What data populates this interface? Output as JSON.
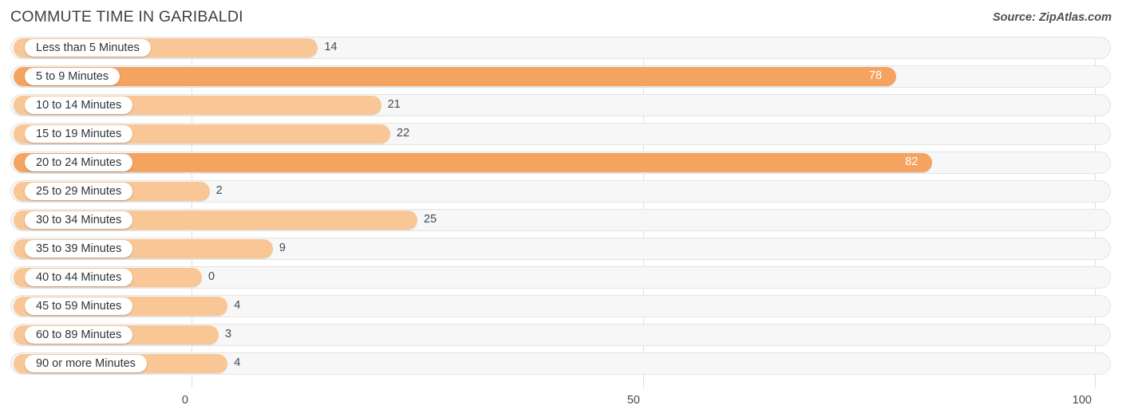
{
  "header": {
    "title": "COMMUTE TIME IN GARIBALDI",
    "source": "Source: ZipAtlas.com"
  },
  "axis": {
    "ticks": [
      {
        "label": "0",
        "value": 0
      },
      {
        "label": "50",
        "value": 50
      },
      {
        "label": "100",
        "value": 100
      }
    ]
  },
  "colors": {
    "bar_light": "#f9c696",
    "bar_strong": "#f4a460",
    "track": "#f7f7f7",
    "track_border": "#e3e3e3",
    "text": "#43484f",
    "title": "#3c4148"
  },
  "chart_data": {
    "type": "bar",
    "orientation": "horizontal",
    "title": "COMMUTE TIME IN GARIBALDI",
    "xlabel": "",
    "ylabel": "",
    "xlim": [
      0,
      100
    ],
    "grid": true,
    "legend": "none",
    "categories": [
      "Less than 5 Minutes",
      "5 to 9 Minutes",
      "10 to 14 Minutes",
      "15 to 19 Minutes",
      "20 to 24 Minutes",
      "25 to 29 Minutes",
      "30 to 34 Minutes",
      "35 to 39 Minutes",
      "40 to 44 Minutes",
      "45 to 59 Minutes",
      "60 to 89 Minutes",
      "90 or more Minutes"
    ],
    "values": [
      14,
      78,
      21,
      22,
      82,
      2,
      25,
      9,
      0,
      4,
      3,
      4
    ],
    "bars": [
      {
        "label": "Less than 5 Minutes",
        "value": 14,
        "value_text": "14",
        "highlight": false
      },
      {
        "label": "5 to 9 Minutes",
        "value": 78,
        "value_text": "78",
        "highlight": true
      },
      {
        "label": "10 to 14 Minutes",
        "value": 21,
        "value_text": "21",
        "highlight": false
      },
      {
        "label": "15 to 19 Minutes",
        "value": 22,
        "value_text": "22",
        "highlight": false
      },
      {
        "label": "20 to 24 Minutes",
        "value": 82,
        "value_text": "82",
        "highlight": true
      },
      {
        "label": "25 to 29 Minutes",
        "value": 2,
        "value_text": "2",
        "highlight": false
      },
      {
        "label": "30 to 34 Minutes",
        "value": 25,
        "value_text": "25",
        "highlight": false
      },
      {
        "label": "35 to 39 Minutes",
        "value": 9,
        "value_text": "9",
        "highlight": false
      },
      {
        "label": "40 to 44 Minutes",
        "value": 0,
        "value_text": "0",
        "highlight": false
      },
      {
        "label": "45 to 59 Minutes",
        "value": 4,
        "value_text": "4",
        "highlight": false
      },
      {
        "label": "60 to 89 Minutes",
        "value": 3,
        "value_text": "3",
        "highlight": false
      },
      {
        "label": "90 or more Minutes",
        "value": 4,
        "value_text": "4",
        "highlight": false
      }
    ]
  }
}
